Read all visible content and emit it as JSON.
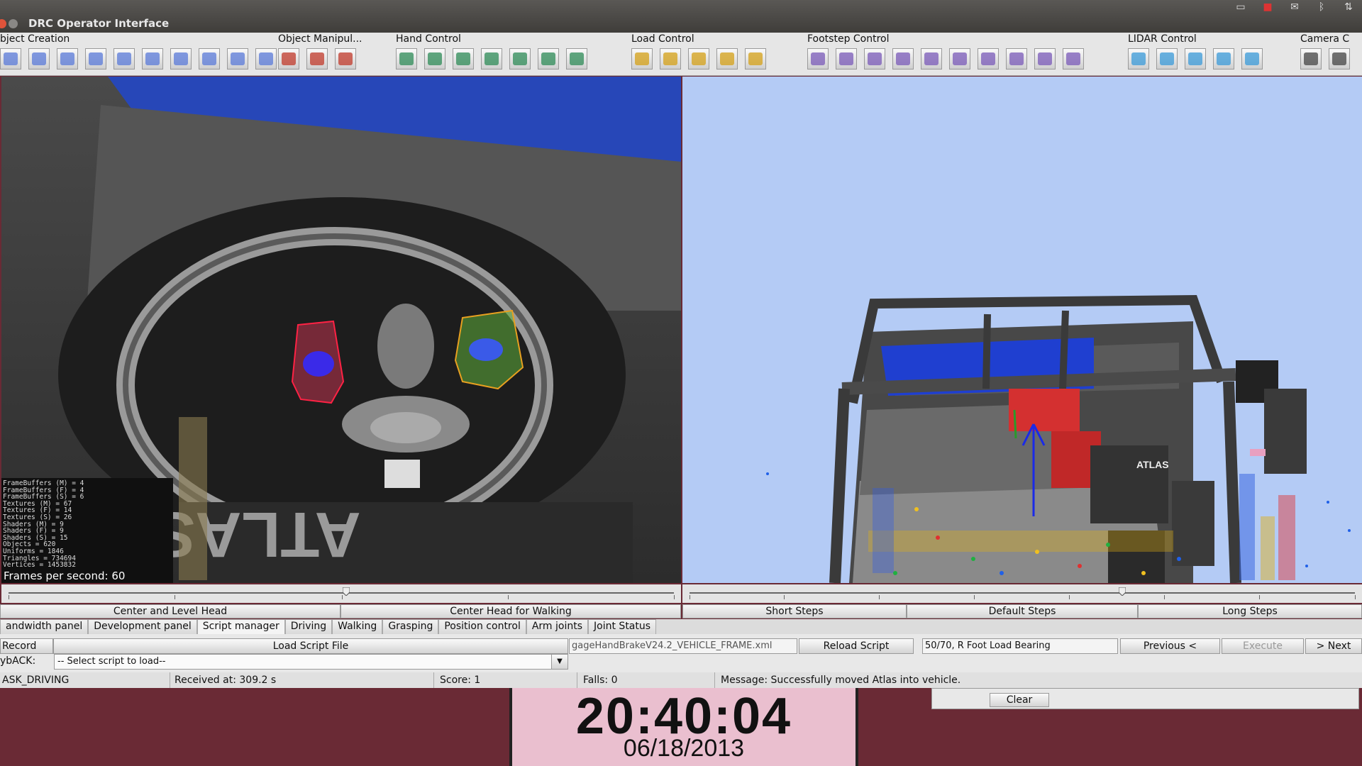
{
  "window": {
    "title": "DRC Operator Interface"
  },
  "tray": [
    "keyboard-icon",
    "battery-icon",
    "mail-icon",
    "bluetooth-icon",
    "network-icon"
  ],
  "toolbar": {
    "groups": [
      {
        "label": "bject Creation",
        "icons": [
          "box-icon",
          "cube-icon",
          "grid-icon",
          "vehicle-icon",
          "update-icon",
          "vehicle2-icon",
          "ring-icon",
          "table-icon",
          "drill-icon",
          "valve-icon"
        ]
      },
      {
        "label": "Object Manipul...",
        "icons": [
          "move-icon",
          "select-box-icon",
          "align-icon"
        ]
      },
      {
        "label": "Hand Control",
        "icons": [
          "place-icon",
          "close-hand-icon",
          "blank-icon",
          "home-hand-icon",
          "grasp-icon",
          "open-hand-icon",
          "place-hand-icon"
        ]
      },
      {
        "label": "Load Control",
        "icons": [
          "load-icon",
          "load2-icon",
          "bump-load-icon",
          "load3-icon",
          "load4-icon"
        ]
      },
      {
        "label": "Footstep Control",
        "icons": [
          "footstep-icon",
          "footstep2-icon",
          "footstep3-icon",
          "footstep4-icon",
          "footstep-grid-icon",
          "footstep5-icon",
          "footstep-delete-icon",
          "snap-icon",
          "turn-icon",
          "bump-icon"
        ]
      },
      {
        "label": "LIDAR Control",
        "icons": [
          "lidar-enable-icon",
          "lidar-disable-icon",
          "lidar-clear-icon",
          "lidar-clear2-icon",
          "lidar-black-icon"
        ]
      },
      {
        "label": "Camera C",
        "icons": [
          "eye-icon",
          "camera-icon"
        ]
      }
    ]
  },
  "stats": {
    "lines": [
      "FrameBuffers (M) = 4",
      "FrameBuffers (F) = 4",
      "FrameBuffers (S) = 6",
      "Textures (M) = 67",
      "Textures (F) = 14",
      "Textures (S) = 26",
      "Shaders (M) = 9",
      "Shaders (F) = 9",
      "Shaders (S) = 15",
      "Objects = 620",
      "Uniforms = 1846",
      "Triangles = 734694",
      "Vertices = 1453832"
    ],
    "fps": "Frames per second: 60"
  },
  "camera_overlay": {
    "floor_text": "ATLAS"
  },
  "scene_overlay": {
    "robot_text": "ATLAS"
  },
  "presets": {
    "head": [
      "Center and Level Head",
      "Center Head for Walking"
    ],
    "steps": [
      "Short Steps",
      "Default Steps",
      "Long Steps"
    ]
  },
  "tabs": {
    "items": [
      "andwidth panel",
      "Development panel",
      "Script manager",
      "Driving",
      "Walking",
      "Grasping",
      "Position control",
      "Arm joints",
      "Joint Status"
    ],
    "active_index": 2
  },
  "script_panel": {
    "record_label": "Record",
    "load_button": "Load Script File",
    "script_file": "gageHandBrakeV24.2_VEHICLE_FRAME.xml",
    "reload_button": "Reload Script",
    "step_status": "50/70, R Foot Load Bearing",
    "previous_button": "Previous <",
    "execute_button": "Execute",
    "next_button": "> Next",
    "playback_label": "ybACK:",
    "select_value": "-- Select script to load--"
  },
  "status": {
    "task": "ASK_DRIVING",
    "received": "Received at:  309.2 s",
    "score": "Score:  1",
    "falls": "Falls:  0",
    "message": "Message:  Successfully moved Atlas into vehicle."
  },
  "message_panel": {
    "clear_button": "Clear"
  },
  "clock": {
    "time": "20:40:04",
    "date": "06/18/2013"
  },
  "colors": {
    "scene_bg": "#b4cbf5",
    "desktop_bg": "#6a2a35",
    "clock_bg": "#eabfcf"
  }
}
